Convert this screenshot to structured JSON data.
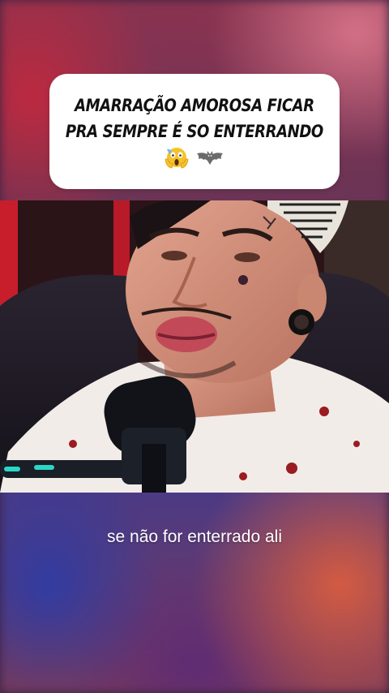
{
  "caption": {
    "line1": "AMARRAÇÃO AMOROSA FICAR",
    "line2": "PRA SEMPRE É SO ENTERRANDO",
    "emojis": [
      "screaming-face",
      "bat"
    ]
  },
  "subtitle": "se não for enterrado ali",
  "colors": {
    "caption_bg": "#ffffff",
    "caption_text": "#111111",
    "subtitle_text": "#ffffff"
  }
}
